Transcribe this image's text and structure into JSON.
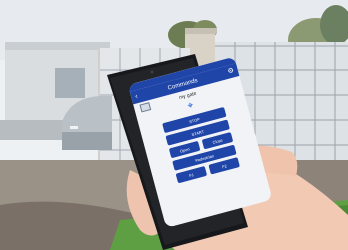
{
  "app": {
    "header_title": "Commands",
    "device_name": "my gate",
    "icons": [
      "back-arrow-icon",
      "gear-icon",
      "wifi-icon",
      "gate-thumbnail-icon"
    ],
    "buttons": {
      "stop": "STOP",
      "start": "START",
      "open": "Open",
      "close": "Close",
      "pedestrian": "Pedestrian",
      "f1": "F1",
      "f2": "F2"
    },
    "colors": {
      "primary": "#1f45a8",
      "screen_bg": "#f1f3f7",
      "wifi": "#1e5bd8"
    }
  }
}
